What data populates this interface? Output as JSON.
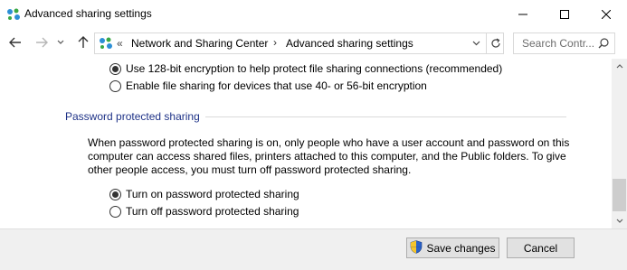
{
  "window": {
    "title": "Advanced sharing settings"
  },
  "nav": {
    "breadcrumb_overflow": "«",
    "crumb1": "Network and Sharing Center",
    "crumb_separator": "›",
    "crumb2": "Advanced sharing settings",
    "search_placeholder": "Search Contr..."
  },
  "encryption": {
    "option1_label": "Use 128-bit encryption to help protect file sharing connections (recommended)",
    "option1_selected": true,
    "option2_label": "Enable file sharing for devices that use 40- or 56-bit encryption",
    "option2_selected": false
  },
  "password_sharing": {
    "heading": "Password protected sharing",
    "description": "When password protected sharing is on, only people who have a user account and password on this computer can access shared files, printers attached to this computer, and the Public folders. To give other people access, you must turn off password protected sharing.",
    "option_on_label": "Turn on password protected sharing",
    "option_on_selected": true,
    "option_off_label": "Turn off password protected sharing",
    "option_off_selected": false
  },
  "footer": {
    "save_label": "Save changes",
    "cancel_label": "Cancel"
  },
  "colors": {
    "heading": "#1e3287",
    "footer_bg": "#f0f0f0",
    "button_bg": "#e1e1e1"
  }
}
